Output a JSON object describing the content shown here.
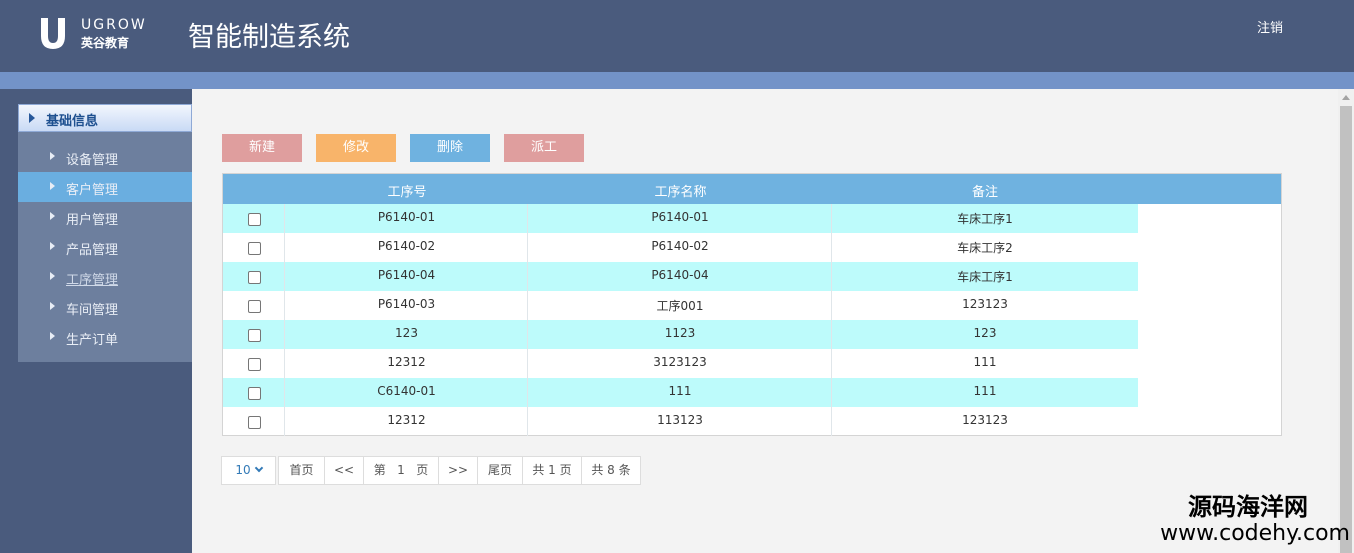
{
  "header": {
    "logo_en": "UGROW",
    "logo_cn": "英谷教育",
    "title": "智能制造系统",
    "logout": "注销"
  },
  "sidebar": {
    "group": "基础信息",
    "items": [
      {
        "label": "设备管理"
      },
      {
        "label": "客户管理"
      },
      {
        "label": "用户管理"
      },
      {
        "label": "产品管理"
      },
      {
        "label": "工序管理"
      },
      {
        "label": "车间管理"
      },
      {
        "label": "生产订单"
      }
    ]
  },
  "toolbar": {
    "new": "新建",
    "edit": "修改",
    "delete": "删除",
    "dispatch": "派工"
  },
  "table": {
    "columns": [
      "工序号",
      "工序名称",
      "备注"
    ],
    "rows": [
      {
        "code": "P6140-01",
        "name": "P6140-01",
        "remark": "车床工序1"
      },
      {
        "code": "P6140-02",
        "name": "P6140-02",
        "remark": "车床工序2"
      },
      {
        "code": "P6140-04",
        "name": "P6140-04",
        "remark": "车床工序1"
      },
      {
        "code": "P6140-03",
        "name": "工序001",
        "remark": "123123"
      },
      {
        "code": "123",
        "name": "1123",
        "remark": "123"
      },
      {
        "code": "12312",
        "name": "3123123",
        "remark": "111"
      },
      {
        "code": "C6140-01",
        "name": "111",
        "remark": "111"
      },
      {
        "code": "12312",
        "name": "113123",
        "remark": "123123"
      }
    ]
  },
  "pager": {
    "page_size": "10",
    "first": "首页",
    "prev": "<<",
    "page_label": "第   1   页",
    "next": ">>",
    "last": "尾页",
    "total_pages": "共 1 页",
    "total_items": "共 8 条"
  },
  "watermark": {
    "cn": "源码海洋网",
    "url": "www.codehy.com"
  }
}
